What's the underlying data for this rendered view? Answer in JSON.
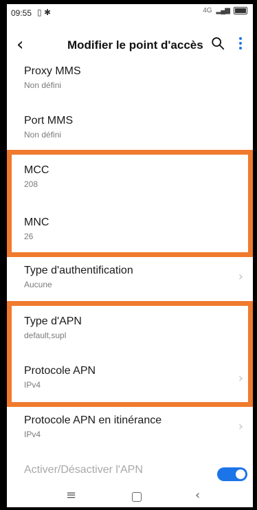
{
  "statusbar": {
    "time": "09:55",
    "network_badge": "4G"
  },
  "appbar": {
    "title": "Modifier le point d'accès"
  },
  "items": [
    {
      "title": "Proxy MMS",
      "value": "Non défini"
    },
    {
      "title": "Port MMS",
      "value": "Non défini"
    },
    {
      "title": "MCC",
      "value": "208"
    },
    {
      "title": "MNC",
      "value": "26"
    },
    {
      "title": "Type d'authentification",
      "value": "Aucune"
    },
    {
      "title": "Type d'APN",
      "value": "default,supl"
    },
    {
      "title": "Protocole APN",
      "value": "IPv4"
    },
    {
      "title": "Protocole APN en itinérance",
      "value": "IPv4"
    },
    {
      "title": "Activer/Désactiver l'APN",
      "toggle_on": true
    }
  ],
  "highlight_color": "#f07a2d",
  "accent_color": "#1b74e8",
  "icons": {
    "back": "arrow-back-icon",
    "search": "search-icon",
    "more": "more-vert-icon",
    "chevron": "chevron-right-icon",
    "nav_recent": "recent-apps-icon",
    "nav_home": "home-icon",
    "nav_back": "back-triangle-icon"
  }
}
